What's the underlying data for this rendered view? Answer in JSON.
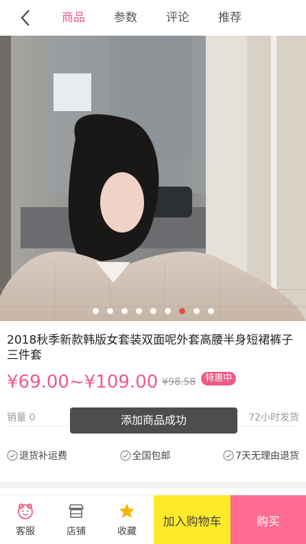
{
  "nav": {
    "tabs": [
      "商品",
      "参数",
      "评论",
      "推荐"
    ],
    "active_index": 0
  },
  "carousel": {
    "slide_count": 9,
    "active_slide": 7
  },
  "product": {
    "title": "2018秋季新款韩版女套装双面呢外套高腰半身短裙裤子三件套",
    "price": "¥69.00~¥109.00",
    "original_price": "¥98.58",
    "badge": "特惠中",
    "sales": "销量 0",
    "shipping": "72小时发货"
  },
  "toast": "添加商品成功",
  "guarantees": [
    "退货补运费",
    "全国包邮",
    "7天无理由退货"
  ],
  "bottombar": {
    "service": "客服",
    "shop": "店铺",
    "favorite": "收藏",
    "add_to_cart": "加入购物车",
    "buy": "购买"
  },
  "colors": {
    "accent": "#ef5a85",
    "cart": "#ffea2a",
    "buy": "#ff6a93"
  }
}
